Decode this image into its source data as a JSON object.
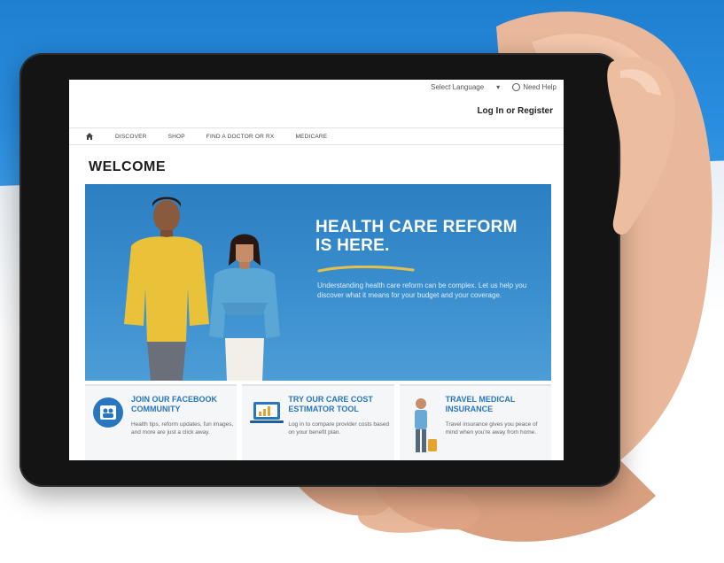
{
  "header": {
    "select_language": "Select Language",
    "need_help": "Need Help",
    "login_register": "Log In or Register"
  },
  "nav": {
    "items": [
      "DISCOVER",
      "SHOP",
      "FIND A DOCTOR OR RX",
      "MEDICARE"
    ]
  },
  "page": {
    "welcome": "WELCOME"
  },
  "hero": {
    "title_line1": "HEALTH CARE REFORM",
    "title_line2": "IS HERE.",
    "copy": "Understanding health care reform can be complex. Let us help you discover what it means for your budget and your coverage."
  },
  "cards": [
    {
      "title": "JOIN OUR FACEBOOK COMMUNITY",
      "text": "Health tips, reform updates, fun images, and more are just a click away.",
      "icon": "facebook-community-icon"
    },
    {
      "title": "TRY OUR CARE COST ESTIMATOR TOOL",
      "text": "Log in to compare provider costs based on your benefit plan.",
      "icon": "laptop-chart-icon"
    },
    {
      "title": "TRAVEL MEDICAL INSURANCE",
      "text": "Travel insurance gives you peace of mind when you're away from home.",
      "icon": "traveler-icon"
    }
  ],
  "colors": {
    "background_blue": "#2a8ee0",
    "hero_blue": "#3a8fcf",
    "link_blue": "#2876bf",
    "tablet_bezel": "#141414"
  }
}
